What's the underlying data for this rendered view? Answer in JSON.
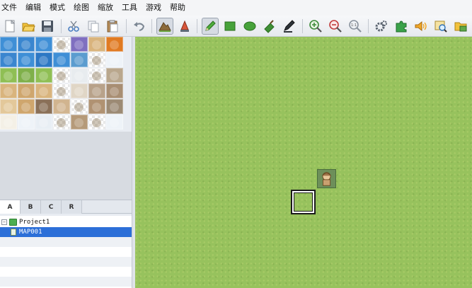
{
  "menubar": {
    "items": [
      "文件",
      "编辑",
      "模式",
      "绘图",
      "缩放",
      "工具",
      "游戏",
      "帮助"
    ]
  },
  "toolbar": {
    "buttons": [
      {
        "icon": "new-project-icon",
        "interactable": true
      },
      {
        "icon": "open-project-icon",
        "interactable": true
      },
      {
        "icon": "save-project-icon",
        "interactable": true
      },
      {
        "icon": "cut-icon",
        "interactable": true
      },
      {
        "icon": "copy-icon",
        "interactable": true
      },
      {
        "icon": "paste-icon",
        "interactable": true
      },
      {
        "icon": "undo-icon",
        "interactable": true
      },
      {
        "icon": "map-mode-icon",
        "pressed": true
      },
      {
        "icon": "event-mode-icon"
      },
      {
        "icon": "pencil-icon",
        "pressed": true
      },
      {
        "icon": "rectangle-icon"
      },
      {
        "icon": "ellipse-icon"
      },
      {
        "icon": "flood-fill-icon"
      },
      {
        "icon": "shadow-pen-icon"
      },
      {
        "icon": "zoom-in-icon"
      },
      {
        "icon": "zoom-out-icon"
      },
      {
        "icon": "zoom-actual-icon",
        "label": "1:1"
      },
      {
        "icon": "database-icon"
      },
      {
        "icon": "plugin-manager-icon"
      },
      {
        "icon": "sound-test-icon"
      },
      {
        "icon": "event-search-icon"
      },
      {
        "icon": "resource-manager-icon"
      }
    ]
  },
  "layer_tabs": [
    "A",
    "B",
    "C",
    "R"
  ],
  "map_tree": {
    "project": "Project1",
    "maps": [
      "MAP001"
    ]
  },
  "colors": {
    "grass": "#97c25d",
    "selection": "#2c6fd8",
    "water": "#3f8fd6",
    "sand": "#d9b47d",
    "snow": "#eef3f8",
    "lava": "#e07a22"
  },
  "tiles": [
    [
      "#3f8fd6",
      "#3a86cf",
      "#3f8fd6",
      "checker",
      "#7f6fc0",
      "#d9b47d",
      "#e07a22"
    ],
    [
      "#3a86cf",
      "#3f8fd6",
      "#2d78c4",
      "#3f8fd6",
      "#5b9ccf",
      "checker",
      "#eef3f8"
    ],
    [
      "#8fbf54",
      "#7fb04a",
      "#8fbf54",
      "checker",
      "#e8ecef",
      "checker",
      "#b9a78d"
    ],
    [
      "#d9b47d",
      "#cfa66d",
      "#d9b47d",
      "checker",
      "#e0d6c6",
      "#b8a28a",
      "#a88e73"
    ],
    [
      "#e3c89a",
      "#cfa66d",
      "#8a7058",
      "#d1b48f",
      "checker",
      "#b09272",
      "#9c8a74"
    ],
    [
      "#f4f0e6",
      "#eef3f8",
      "#e8eef4",
      "checker",
      "#b59a79",
      "checker",
      "#eef3f8"
    ]
  ]
}
